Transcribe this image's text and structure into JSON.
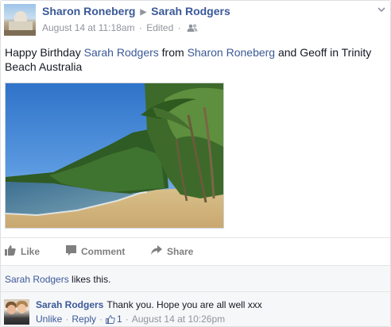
{
  "post": {
    "author": "Sharon Roneberg",
    "target": "Sarah Rodgers",
    "timestamp": "August 14 at 11:18am",
    "edited": "Edited",
    "separator": "·",
    "text_prefix": "Happy Birthday ",
    "text_tag1": "Sarah Rodgers",
    "text_mid": " from ",
    "text_tag2": "Sharon Roneberg",
    "text_suffix": " and Geoff in Trinity Beach Australia"
  },
  "actions": {
    "like": "Like",
    "comment": "Comment",
    "share": "Share"
  },
  "likes": {
    "name": "Sarah Rodgers",
    "suffix": " likes this."
  },
  "comment": {
    "author": "Sarah Rodgers",
    "text": "Thank you. Hope you are all well xxx",
    "unlike": "Unlike",
    "reply": "Reply",
    "like_count": "1",
    "timestamp": "August 14 at 10:26pm",
    "separator": "·"
  },
  "colors": {
    "link": "#3b5998",
    "meta": "#90949c",
    "action": "#7f7f7f",
    "bar_bg": "#f6f7f9"
  },
  "icons": {
    "audience": "friends-icon",
    "options": "chevron-down-icon",
    "like": "thumbs-up-icon",
    "comment": "speech-bubble-icon",
    "share": "share-arrow-icon"
  }
}
